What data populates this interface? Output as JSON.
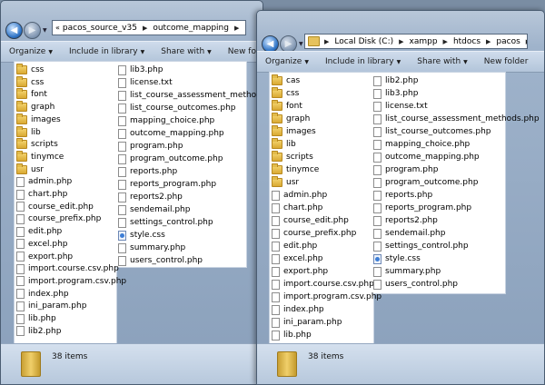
{
  "toolbar": {
    "organize": "Organize",
    "include": "Include in library",
    "share": "Share with",
    "newfolder": "New folder"
  },
  "windowA": {
    "path": [
      "pacos_source_v35",
      "outcome_mapping"
    ],
    "col1": [
      {
        "name": "css",
        "type": "folder"
      },
      {
        "name": "css",
        "type": "folder"
      },
      {
        "name": "font",
        "type": "folder"
      },
      {
        "name": "graph",
        "type": "folder"
      },
      {
        "name": "images",
        "type": "folder"
      },
      {
        "name": "lib",
        "type": "folder"
      },
      {
        "name": "scripts",
        "type": "folder"
      },
      {
        "name": "tinymce",
        "type": "folder"
      },
      {
        "name": "usr",
        "type": "folder"
      },
      {
        "name": "admin.php",
        "type": "file"
      },
      {
        "name": "chart.php",
        "type": "file"
      },
      {
        "name": "course_edit.php",
        "type": "file"
      },
      {
        "name": "course_prefix.php",
        "type": "file"
      },
      {
        "name": "edit.php",
        "type": "file"
      },
      {
        "name": "excel.php",
        "type": "file"
      },
      {
        "name": "export.php",
        "type": "file"
      },
      {
        "name": "import.course.csv.php",
        "type": "file"
      },
      {
        "name": "import.program.csv.php",
        "type": "file"
      },
      {
        "name": "index.php",
        "type": "file"
      },
      {
        "name": "ini_param.php",
        "type": "file"
      },
      {
        "name": "lib.php",
        "type": "file"
      },
      {
        "name": "lib2.php",
        "type": "file"
      }
    ],
    "col2": [
      {
        "name": "lib3.php",
        "type": "file"
      },
      {
        "name": "license.txt",
        "type": "file"
      },
      {
        "name": "list_course_assessment_methods.php",
        "type": "file"
      },
      {
        "name": "list_course_outcomes.php",
        "type": "file"
      },
      {
        "name": "mapping_choice.php",
        "type": "file"
      },
      {
        "name": "outcome_mapping.php",
        "type": "file"
      },
      {
        "name": "program.php",
        "type": "file"
      },
      {
        "name": "program_outcome.php",
        "type": "file"
      },
      {
        "name": "reports.php",
        "type": "file"
      },
      {
        "name": "reports_program.php",
        "type": "file"
      },
      {
        "name": "reports2.php",
        "type": "file"
      },
      {
        "name": "sendemail.php",
        "type": "file"
      },
      {
        "name": "settings_control.php",
        "type": "file"
      },
      {
        "name": "style.css",
        "type": "css"
      },
      {
        "name": "summary.php",
        "type": "file"
      },
      {
        "name": "users_control.php",
        "type": "file"
      }
    ],
    "status": "38 items"
  },
  "windowB": {
    "path": [
      "Local Disk (C:)",
      "xampp",
      "htdocs",
      "pacos"
    ],
    "col1": [
      {
        "name": "cas",
        "type": "folder"
      },
      {
        "name": "css",
        "type": "folder"
      },
      {
        "name": "font",
        "type": "folder"
      },
      {
        "name": "graph",
        "type": "folder"
      },
      {
        "name": "images",
        "type": "folder"
      },
      {
        "name": "lib",
        "type": "folder"
      },
      {
        "name": "scripts",
        "type": "folder"
      },
      {
        "name": "tinymce",
        "type": "folder"
      },
      {
        "name": "usr",
        "type": "folder"
      },
      {
        "name": "admin.php",
        "type": "file"
      },
      {
        "name": "chart.php",
        "type": "file"
      },
      {
        "name": "course_edit.php",
        "type": "file"
      },
      {
        "name": "course_prefix.php",
        "type": "file"
      },
      {
        "name": "edit.php",
        "type": "file"
      },
      {
        "name": "excel.php",
        "type": "file"
      },
      {
        "name": "export.php",
        "type": "file"
      },
      {
        "name": "import.course.csv.php",
        "type": "file"
      },
      {
        "name": "import.program.csv.php",
        "type": "file"
      },
      {
        "name": "index.php",
        "type": "file"
      },
      {
        "name": "ini_param.php",
        "type": "file"
      },
      {
        "name": "lib.php",
        "type": "file"
      }
    ],
    "col2": [
      {
        "name": "lib2.php",
        "type": "file"
      },
      {
        "name": "lib3.php",
        "type": "file"
      },
      {
        "name": "license.txt",
        "type": "file"
      },
      {
        "name": "list_course_assessment_methods.php",
        "type": "file"
      },
      {
        "name": "list_course_outcomes.php",
        "type": "file"
      },
      {
        "name": "mapping_choice.php",
        "type": "file"
      },
      {
        "name": "outcome_mapping.php",
        "type": "file"
      },
      {
        "name": "program.php",
        "type": "file"
      },
      {
        "name": "program_outcome.php",
        "type": "file"
      },
      {
        "name": "reports.php",
        "type": "file"
      },
      {
        "name": "reports_program.php",
        "type": "file"
      },
      {
        "name": "reports2.php",
        "type": "file"
      },
      {
        "name": "sendemail.php",
        "type": "file"
      },
      {
        "name": "settings_control.php",
        "type": "file"
      },
      {
        "name": "style.css",
        "type": "css"
      },
      {
        "name": "summary.php",
        "type": "file"
      },
      {
        "name": "users_control.php",
        "type": "file"
      }
    ],
    "status": "38 items"
  }
}
